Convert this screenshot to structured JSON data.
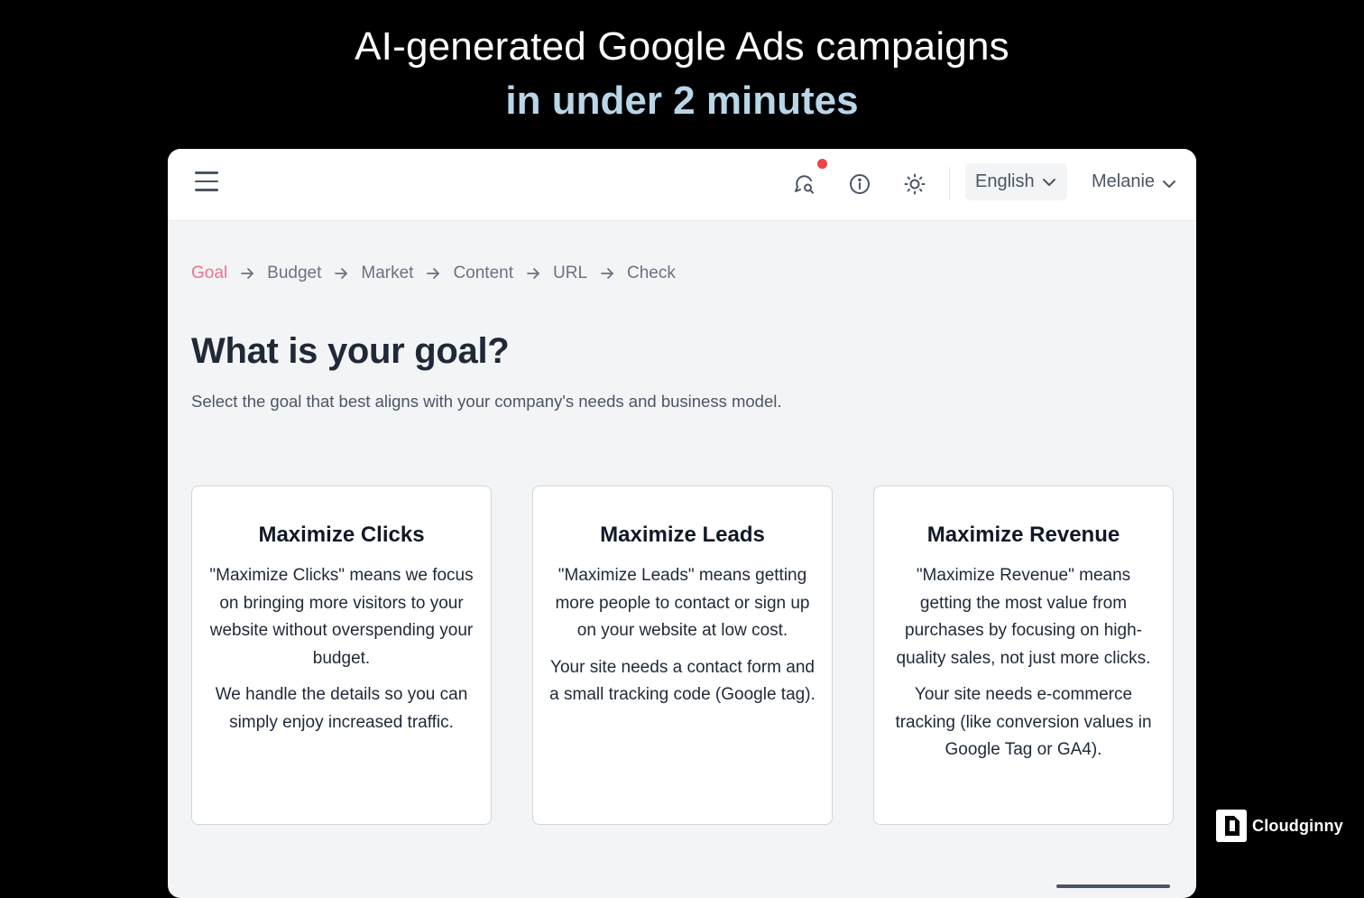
{
  "hero": {
    "line1": "AI-generated Google Ads campaigns",
    "line2": "in under 2 minutes",
    "accent_color": "#b9d6e8"
  },
  "topbar": {
    "menu_icon": "hamburger-menu-icon",
    "actions": [
      {
        "icon": "chat-search-icon",
        "has_notification": true
      },
      {
        "icon": "info-icon"
      },
      {
        "icon": "sun-icon"
      }
    ],
    "language": "English",
    "user": "Melanie",
    "notification_color": "#ef4444"
  },
  "breadcrumb": {
    "steps": [
      "Goal",
      "Budget",
      "Market",
      "Content",
      "URL",
      "Check"
    ],
    "active_index": 0,
    "active_color": "#f0708a"
  },
  "main": {
    "title": "What is your goal?",
    "subtitle": "Select the goal that best aligns with your company's needs and business model."
  },
  "goals": [
    {
      "title": "Maximize Clicks",
      "paragraphs": [
        "\"Maximize Clicks\" means we focus on bringing more visitors to your website without overspending your budget.",
        "We handle the details so you can simply enjoy increased traffic."
      ]
    },
    {
      "title": "Maximize Leads",
      "paragraphs": [
        "\"Maximize Leads\" means getting more people to contact or sign up on your website at low cost.",
        "Your site needs a contact form and a small tracking code (Google tag)."
      ]
    },
    {
      "title": "Maximize Revenue",
      "paragraphs": [
        "\"Maximize Revenue\" means getting the most value from purchases by focusing on high-quality sales, not just more clicks.",
        "Your site needs e-commerce tracking (like conversion values in Google Tag or GA4)."
      ]
    }
  ],
  "watermark": {
    "brand": "Cloudginny"
  }
}
